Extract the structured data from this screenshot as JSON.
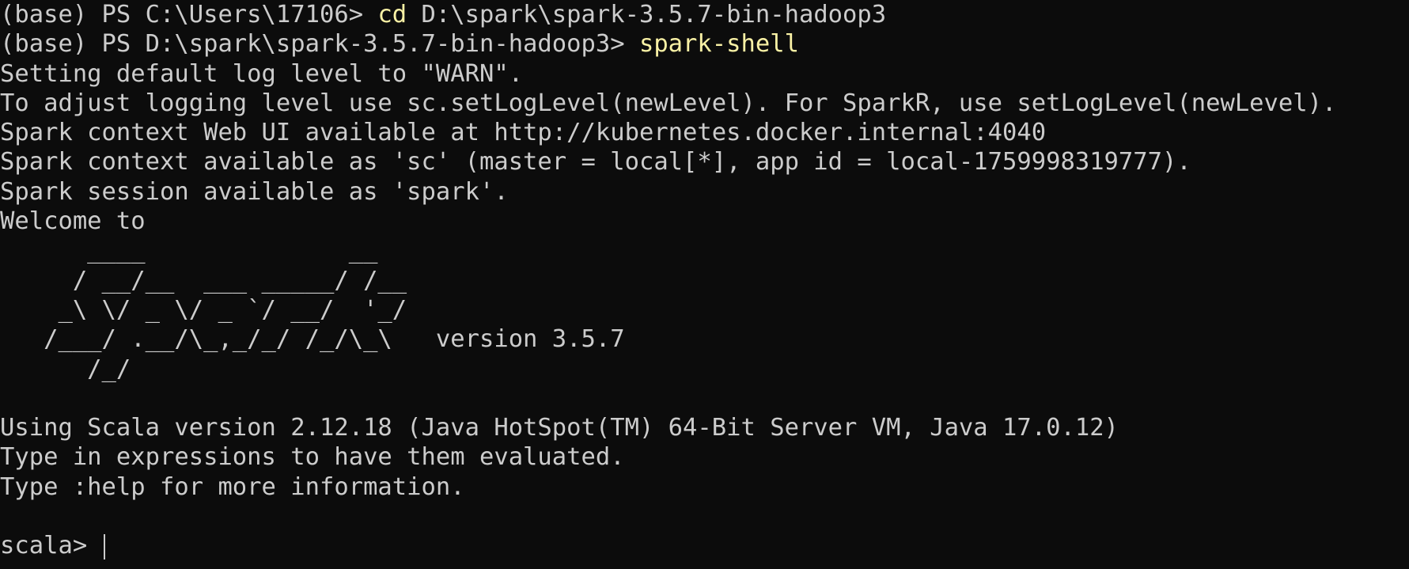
{
  "terminal": {
    "lines": [
      {
        "prompt": "(base) PS C:\\Users\\17106> ",
        "command": "cd",
        "rest": " D:\\spark\\spark-3.5.7-bin-hadoop3"
      },
      {
        "prompt": "(base) PS D:\\spark\\spark-3.5.7-bin-hadoop3> ",
        "command": "spark-shell",
        "rest": ""
      },
      {
        "text": "Setting default log level to \"WARN\"."
      },
      {
        "text": "To adjust logging level use sc.setLogLevel(newLevel). For SparkR, use setLogLevel(newLevel)."
      },
      {
        "text": "Spark context Web UI available at http://kubernetes.docker.internal:4040"
      },
      {
        "text": "Spark context available as 'sc' (master = local[*], app id = local-1759998319777)."
      },
      {
        "text": "Spark session available as 'spark'."
      },
      {
        "text": "Welcome to"
      },
      {
        "text": "      ____              __"
      },
      {
        "text": "     / __/__  ___ _____/ /__"
      },
      {
        "text": "    _\\ \\/ _ \\/ _ `/ __/  '_/"
      },
      {
        "text": "   /___/ .__/\\_,_/_/ /_/\\_\\   version 3.5.7"
      },
      {
        "text": "      /_/"
      },
      {
        "text": ""
      },
      {
        "text": "Using Scala version 2.12.18 (Java HotSpot(TM) 64-Bit Server VM, Java 17.0.12)"
      },
      {
        "text": "Type in expressions to have them evaluated."
      },
      {
        "text": "Type :help for more information."
      },
      {
        "text": ""
      },
      {
        "text": "scala> "
      }
    ]
  },
  "colors": {
    "background": "#0c0c0c",
    "foreground": "#cccccc",
    "command": "#f9f1a5"
  }
}
